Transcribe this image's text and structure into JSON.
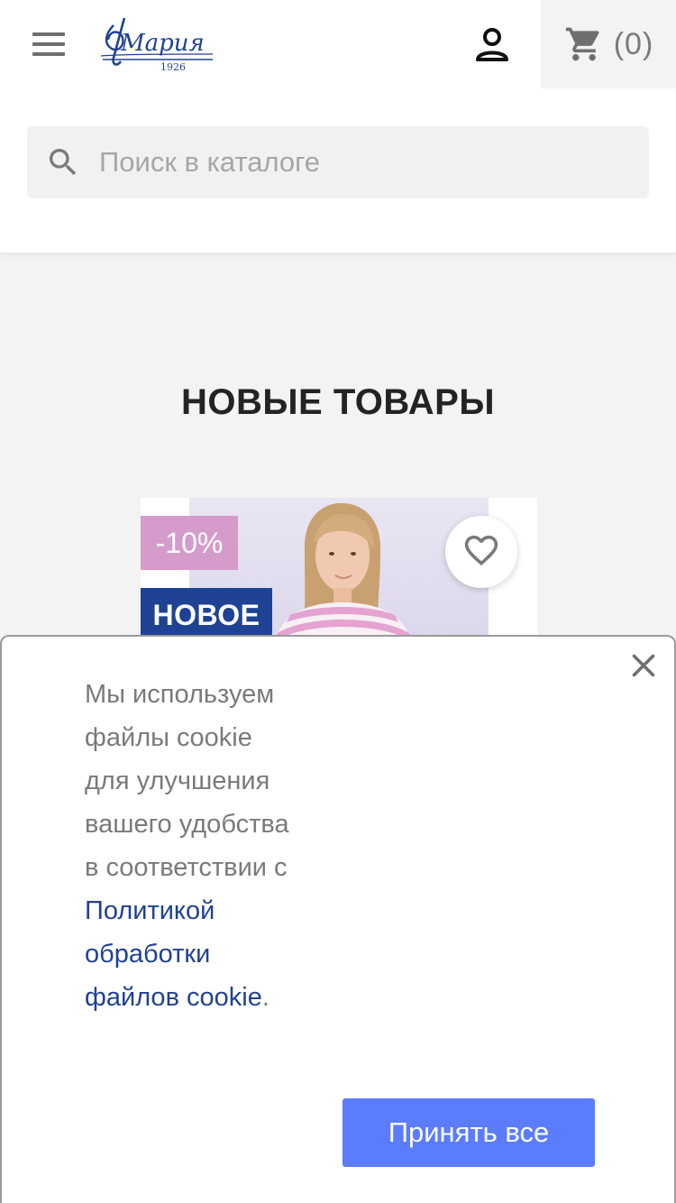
{
  "header": {
    "logo_text": "Мария",
    "logo_year": "1926",
    "cart_count": "(0)"
  },
  "search": {
    "placeholder": "Поиск в каталоге"
  },
  "section": {
    "title": "НОВЫЕ ТОВАРЫ"
  },
  "product": {
    "discount_badge": "-10%",
    "new_badge": "НОВОЕ"
  },
  "cookie": {
    "text_before": "Мы используем файлы cookie для улучшения вашего удобства в соответствии с ",
    "link_text": "Политикой обработки файлов cookie",
    "text_after": ".",
    "accept_label": "Принять все"
  },
  "colors": {
    "brand_blue": "#1f4294",
    "accept_button": "#5b7cff",
    "discount_badge": "#d49bcb",
    "page_background": "#f3f3f3"
  },
  "icons": {
    "menu": "hamburger-menu-icon",
    "user": "user-icon",
    "cart": "shopping-cart-icon",
    "search": "search-icon",
    "wishlist": "heart-outline-icon",
    "close": "close-icon"
  }
}
